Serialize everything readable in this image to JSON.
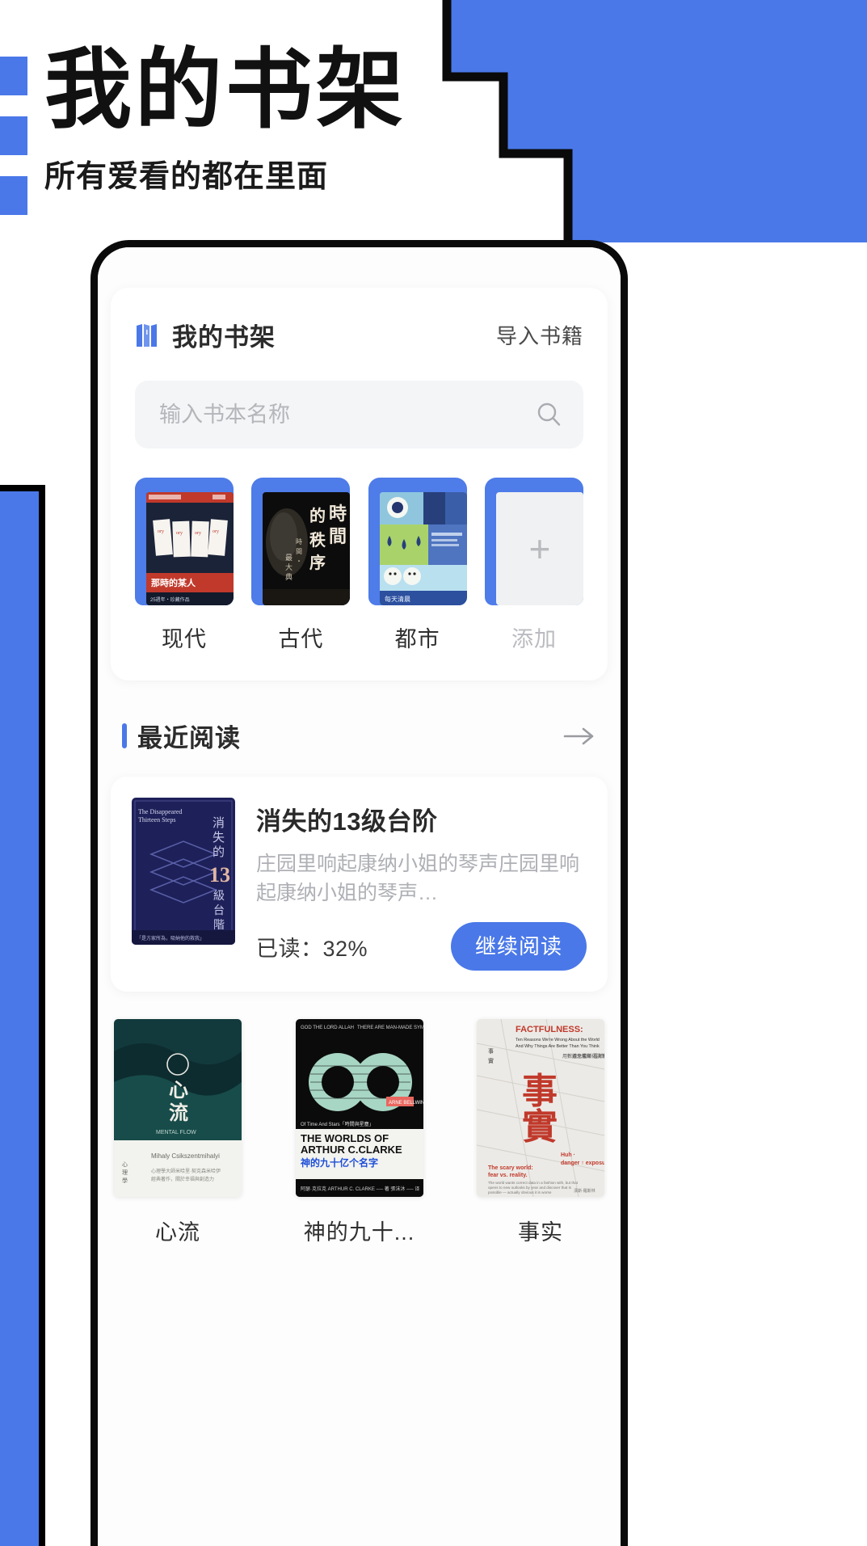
{
  "page": {
    "title": "我的书架",
    "subtitle": "所有爱看的都在里面",
    "accent_color": "#4a78e8",
    "outline_color": "#0a0a0a"
  },
  "shelf": {
    "logo_icon": "books-icon",
    "title": "我的书架",
    "import_label": "导入书籍",
    "search": {
      "placeholder": "输入书本名称",
      "value": "",
      "icon": "search-icon"
    },
    "categories": [
      {
        "label": "现代",
        "cover": "modern-cover",
        "muted": false
      },
      {
        "label": "古代",
        "cover": "ancient-cover",
        "muted": false
      },
      {
        "label": "都市",
        "cover": "city-cover",
        "muted": false
      },
      {
        "label": "添加",
        "cover": "add-placeholder",
        "muted": true,
        "add_glyph": "+"
      }
    ]
  },
  "recent": {
    "title": "最近阅读",
    "more_icon": "arrow-right-icon",
    "featured": {
      "title": "消失的13级台阶",
      "description": "庄园里响起康纳小姐的琴声庄园里响起康纳小姐的琴声…",
      "progress_label": "已读：32%",
      "progress_percent": 32,
      "continue_label": "继续阅读",
      "cover_title": "The Disappeared Thirteen Steps"
    },
    "books": [
      {
        "name": "心流",
        "cover": "flow-cover"
      },
      {
        "name": "神的九十...",
        "cover": "clarke-cover"
      },
      {
        "name": "事实",
        "cover": "factfulness-cover"
      }
    ]
  }
}
